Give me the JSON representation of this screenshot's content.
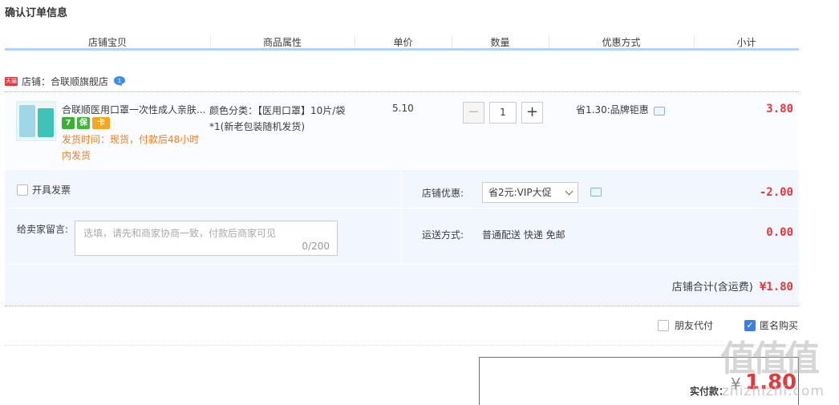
{
  "page_title": "确认订单信息",
  "columns": [
    "店铺宝贝",
    "商品属性",
    "单价",
    "数量",
    "优惠方式",
    "小计"
  ],
  "shop": {
    "logo_text": "天猫",
    "label": "店铺：合联顺旗舰店",
    "wangwang_badge": "1"
  },
  "item": {
    "name": "合联顺医用口罩一次性成人亲肤...",
    "badges": [
      "7",
      "保",
      "卡"
    ],
    "ship_time": "发货时间：现货，付款后48小时内发货",
    "attr": "颜色分类：【医用口罩】10片/袋*1(新老包装随机发货)",
    "price": "5.10",
    "qty_minus": "−",
    "qty": "1",
    "qty_plus": "+",
    "promo": "省1.30:品牌钜惠",
    "subtotal": "3.80"
  },
  "invoice_label": "开具发票",
  "shop_discount": {
    "label": "店铺优惠:",
    "selected": "省2元:VIP大促",
    "value": "-2.00"
  },
  "message": {
    "label": "给卖家留言:",
    "placeholder": "选填，请先和商家协商一致，付款后商家可见",
    "count": "0/200"
  },
  "shipping": {
    "label": "运送方式:",
    "value": "普通配送 快递 免邮",
    "fee": "0.00"
  },
  "shop_total": {
    "label": "店铺合计(含运费)",
    "amount": "¥1.80"
  },
  "options": {
    "friend_pay": "朋友代付",
    "anonymous": "匿名购买",
    "anonymous_checked": true
  },
  "payment": {
    "label": "实付款：",
    "currency": "¥",
    "amount": "1.80"
  },
  "watermark": {
    "main": "值值值",
    "sub": "zhizhizhi.com"
  },
  "colors": {
    "accent_red": "#e4393c",
    "header_line": "#b2d1ff",
    "panel_bg": "#f2f7ff",
    "ship_orange": "#f07e22",
    "check_blue": "#3d7fe0"
  }
}
